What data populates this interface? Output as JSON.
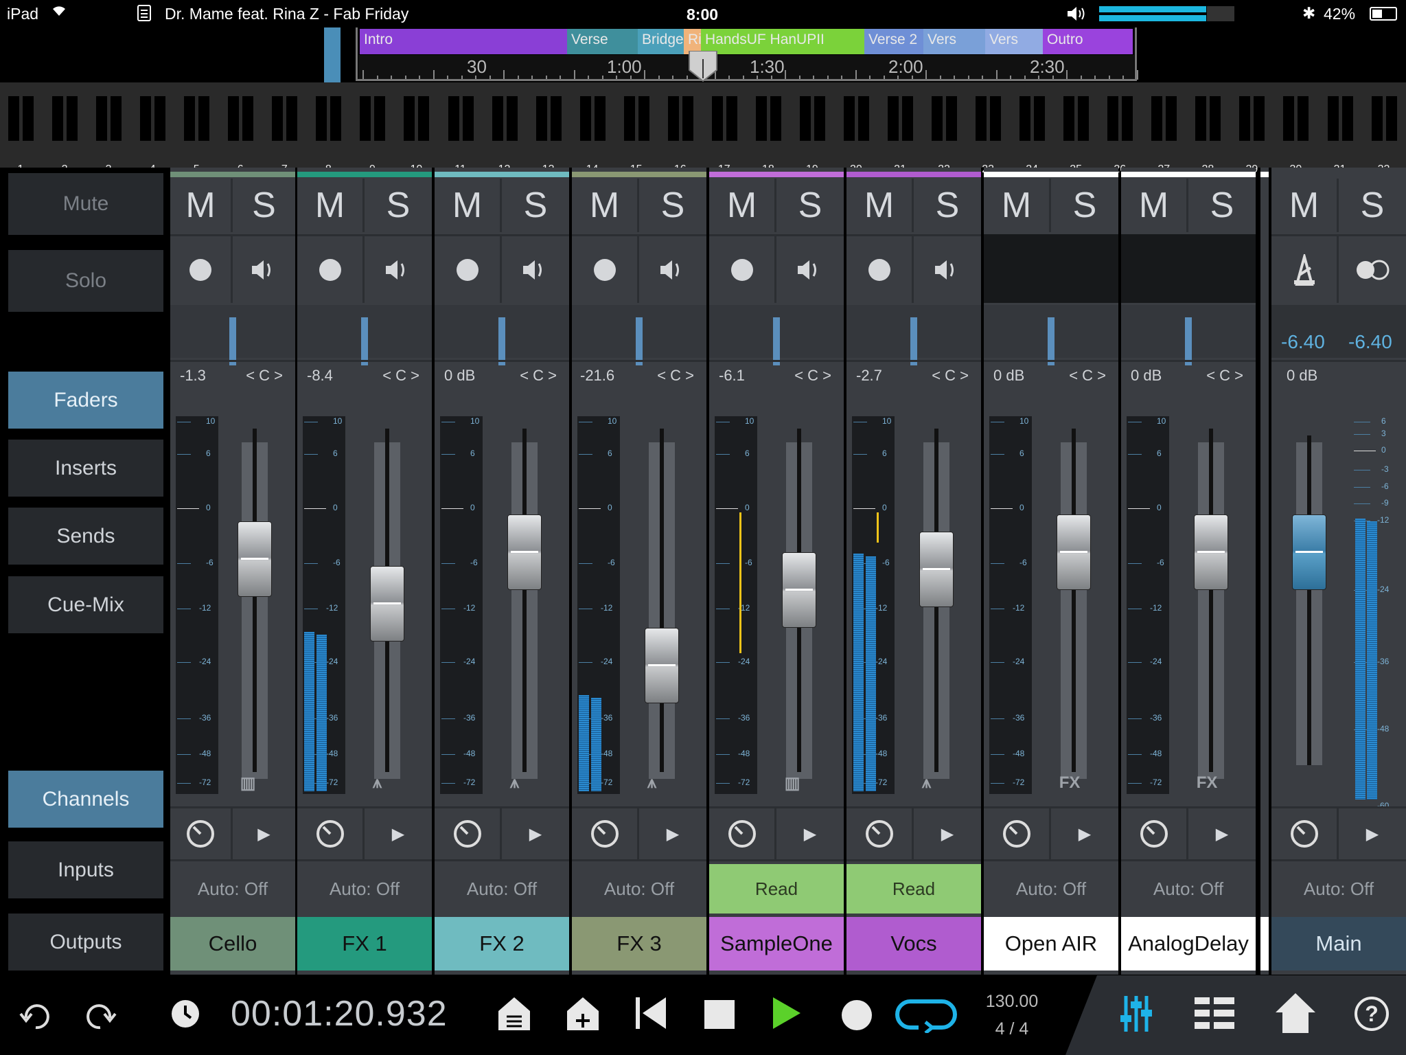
{
  "status": {
    "carrier": "iPad",
    "song": "Dr. Mame feat. Rina Z - Fab Friday",
    "time": "8:00",
    "volume_fraction": 0.79,
    "battery": "42%"
  },
  "arrangement": {
    "sections": [
      {
        "label": "Intro",
        "color": "#8a3fd6"
      },
      {
        "label": "Verse",
        "color": "#3f8f9c"
      },
      {
        "label": "Bridge",
        "color": "#4ba0ba"
      },
      {
        "label": "Rise",
        "color": "#f0b37a"
      },
      {
        "label": "HandsUF HanUPII",
        "color": "#7bd23a"
      },
      {
        "label": "Verse 2",
        "color": "#6f8fd6"
      },
      {
        "label": "Vers",
        "color": "#7aa0d8"
      },
      {
        "label": "Vers",
        "color": "#91abe3"
      },
      {
        "label": "Outro",
        "color": "#9a43dd"
      }
    ],
    "ruler_labels": [
      "30",
      "1:00",
      "1:30",
      "2:00",
      "2:30"
    ]
  },
  "bank_numbers": [
    "1",
    "2",
    "3",
    "4",
    "5",
    "6",
    "7",
    "8",
    "9",
    "10",
    "11",
    "12",
    "13",
    "14",
    "15",
    "16",
    "17",
    "18",
    "19",
    "20",
    "21",
    "22",
    "23",
    "24",
    "25",
    "26",
    "27",
    "28",
    "29",
    "30",
    "31",
    "32"
  ],
  "nav": {
    "mute": "Mute",
    "solo": "Solo",
    "faders": "Faders",
    "inserts": "Inserts",
    "sends": "Sends",
    "cue_mix": "Cue-Mix",
    "channels": "Channels",
    "inputs": "Inputs",
    "outputs": "Outputs"
  },
  "strip_labels": {
    "mute": "M",
    "solo": "S",
    "pan": "< C >"
  },
  "meter_scale": [
    "10",
    "6",
    "0",
    "-6",
    "-12",
    "-24",
    "-36",
    "-48",
    "-72"
  ],
  "main_scale": [
    "6",
    "3",
    "0",
    "-3",
    "-6",
    "-9",
    "-12",
    "-24",
    "-36",
    "-48",
    "-60"
  ],
  "channels": [
    {
      "name": "Cello",
      "color": "#6f9078",
      "name_color": "#111",
      "volume": "-1.3",
      "auto": "Auto: Off",
      "auto_read": false,
      "type_icon": "piano-keys-icon",
      "type_glyph": "▥",
      "fader_level": 0.73,
      "meter_level": 0,
      "has_rec": true
    },
    {
      "name": "FX 1",
      "color": "#249a7e",
      "name_color": "#111",
      "volume": "-8.4",
      "auto": "Auto: Off",
      "auto_read": false,
      "type_icon": "waveform-icon",
      "type_glyph": "⩚",
      "fader_level": 0.6,
      "meter_level": 0.43,
      "has_rec": true
    },
    {
      "name": "FX 2",
      "color": "#6fbbc0",
      "name_color": "#111",
      "volume": "0 dB",
      "auto": "Auto: Off",
      "auto_read": false,
      "type_icon": "waveform-icon",
      "type_glyph": "⩚",
      "fader_level": 0.75,
      "meter_level": 0,
      "has_rec": true
    },
    {
      "name": "FX 3",
      "color": "#8a9873",
      "name_color": "#111",
      "volume": "-21.6",
      "auto": "Auto: Off",
      "auto_read": false,
      "type_icon": "waveform-icon",
      "type_glyph": "⩚",
      "fader_level": 0.42,
      "meter_level": 0.26,
      "has_rec": true
    },
    {
      "name": "SampleOne",
      "color": "#c06dd8",
      "name_color": "#111",
      "volume": "-6.1",
      "auto": "Read",
      "auto_read": true,
      "type_icon": "piano-keys-icon",
      "type_glyph": "▥",
      "fader_level": 0.64,
      "meter_level": 0,
      "has_rec": true
    },
    {
      "name": "Vocs",
      "color": "#b05ccf",
      "name_color": "#111",
      "volume": "-2.7",
      "auto": "Read",
      "auto_read": true,
      "type_icon": "waveform-icon",
      "type_glyph": "⩚",
      "fader_level": 0.7,
      "meter_level": 0.64,
      "has_rec": true
    },
    {
      "name": "Open AIR",
      "color": "#ffffff",
      "name_color": "#111",
      "volume": "0 dB",
      "auto": "Auto: Off",
      "auto_read": false,
      "type_icon": "fx-label",
      "type_glyph": "FX",
      "fader_level": 0.75,
      "meter_level": 0,
      "has_rec": false
    },
    {
      "name": "AnalogDelay",
      "color": "#ffffff",
      "name_color": "#111",
      "volume": "0 dB",
      "auto": "Auto: Off",
      "auto_read": false,
      "type_icon": "fx-label",
      "type_glyph": "FX",
      "fader_level": 0.75,
      "meter_level": 0,
      "has_rec": false
    }
  ],
  "main": {
    "name": "Main",
    "volume": "0 dB",
    "left_level": "-6.40",
    "right_level": "-6.40",
    "auto": "Auto: Off",
    "fader_level": 0.75,
    "meter_level": 0.9
  },
  "transport": {
    "time": "00:01:20.932",
    "tempo": "130.00",
    "signature": "4 / 4"
  }
}
